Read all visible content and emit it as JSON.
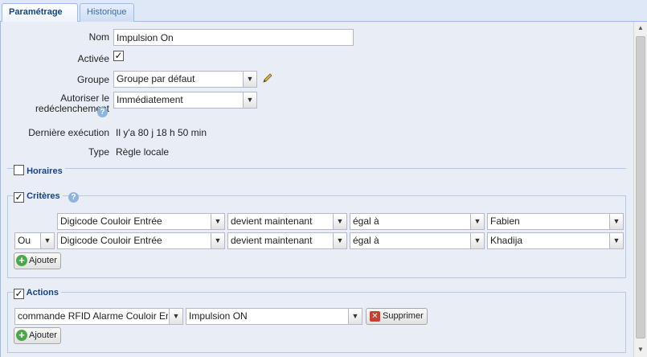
{
  "tabs": [
    {
      "label": "Paramétrage",
      "active": true
    },
    {
      "label": "Historique",
      "active": false
    }
  ],
  "form": {
    "nom_label": "Nom",
    "nom_value": "Impulsion On",
    "activee_label": "Activée",
    "activee_checked": true,
    "groupe_label": "Groupe",
    "groupe_value": "Groupe par défaut",
    "autoriser_label_1": "Autoriser le",
    "autoriser_label_2": "redéclenchement",
    "autoriser_value": "Immédiatement",
    "derniere_label": "Dernière exécution",
    "derniere_value": "Il y'a 80 j 18 h 50 min",
    "type_label": "Type",
    "type_value": "Règle locale"
  },
  "horaires": {
    "label": "Horaires",
    "checked": false
  },
  "criteres": {
    "label": "Critères",
    "checked": true,
    "rows": [
      {
        "connector": "",
        "device": "Digicode Couloir Entrée",
        "event": "devient maintenant",
        "op": "égal à",
        "value": "Fabien"
      },
      {
        "connector": "Ou",
        "device": "Digicode Couloir Entrée",
        "event": "devient maintenant",
        "op": "égal à",
        "value": "Khadija"
      }
    ],
    "add_label": "Ajouter"
  },
  "actions": {
    "label": "Actions",
    "checked": true,
    "rows": [
      {
        "command": "commande RFID Alarme Couloir Entrée",
        "value": "Impulsion ON",
        "delete_label": "Supprimer"
      }
    ],
    "add_label": "Ajouter"
  },
  "icons": {
    "check": "check-icon",
    "dropdown": "chevron-down-icon",
    "edit": "pencil-icon",
    "help": "help-icon",
    "add": "plus-icon",
    "delete": "delete-icon"
  }
}
